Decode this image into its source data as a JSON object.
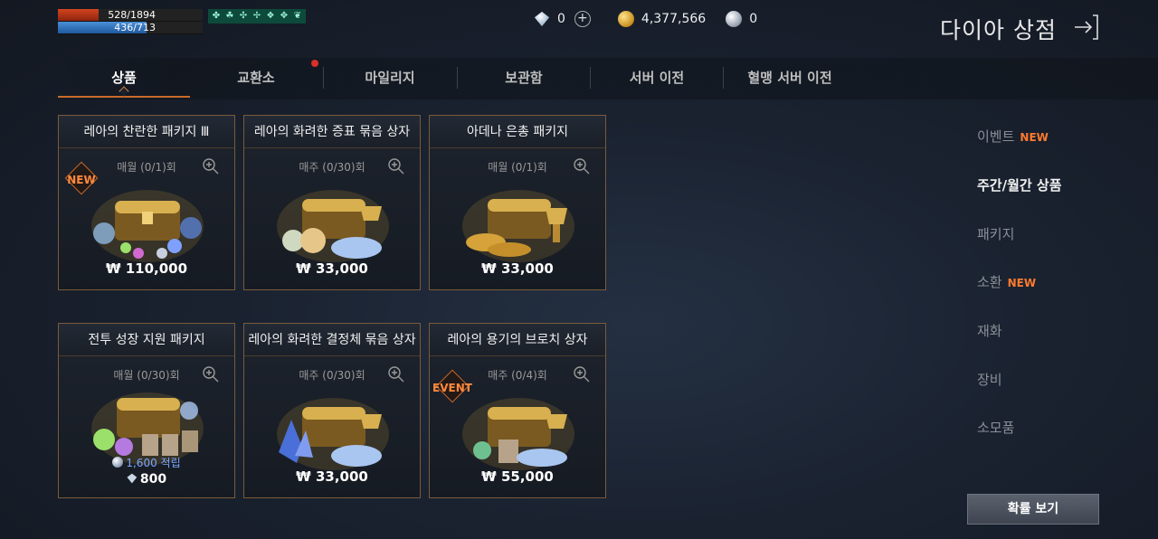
{
  "player": {
    "hp_text": "528/1894",
    "hp_ratio": 0.279,
    "mp_text": "436/713",
    "mp_ratio": 0.611,
    "buff_icons": [
      "buff-1-icon",
      "buff-2-icon",
      "buff-3-icon",
      "buff-4-icon",
      "buff-5-icon",
      "buff-6-icon",
      "buff-7-icon"
    ]
  },
  "currency": {
    "diamond": "0",
    "gold": "4,377,566",
    "silver": "0"
  },
  "header": {
    "title": "다이아 상점"
  },
  "tabs": [
    {
      "label": "상품",
      "active": true
    },
    {
      "label": "교환소",
      "active": false,
      "notify": true
    },
    {
      "label": "마일리지",
      "active": false
    },
    {
      "label": "보관함",
      "active": false
    },
    {
      "label": "서버 이전",
      "active": false
    },
    {
      "label": "혈맹 서버 이전",
      "active": false
    }
  ],
  "products": [
    {
      "name": "레아의 찬란한 패키지 Ⅲ",
      "limit": "매월 (0/1)회",
      "price": "₩ 110,000",
      "badge": "NEW"
    },
    {
      "name": "레아의 화려한 증표 묶음 상자",
      "limit": "매주 (0/30)회",
      "price": "₩ 33,000"
    },
    {
      "name": "아데나 은총 패키지",
      "limit": "매월 (0/1)회",
      "price": "₩ 33,000"
    },
    {
      "name": "전투 성장 지원 패키지",
      "limit": "매월 (0/30)회",
      "bonus": "1,600",
      "bonus_label": "적립",
      "price": "800"
    },
    {
      "name": "레아의 화려한 결정체 묶음 상자",
      "limit": "매주 (0/30)회",
      "price": "₩ 33,000"
    },
    {
      "name": "레아의 용기의 브로치 상자",
      "limit": "매주 (0/4)회",
      "price": "₩ 55,000",
      "badge": "EVENT"
    }
  ],
  "menu": {
    "items": [
      {
        "label": "이벤트",
        "new": "NEW"
      },
      {
        "label": "주간/월간 상품",
        "active": true
      },
      {
        "label": "패키지"
      },
      {
        "label": "소환",
        "new": "NEW"
      },
      {
        "label": "재화"
      },
      {
        "label": "장비"
      },
      {
        "label": "소모품"
      }
    ],
    "probability_button": "확률 보기"
  }
}
